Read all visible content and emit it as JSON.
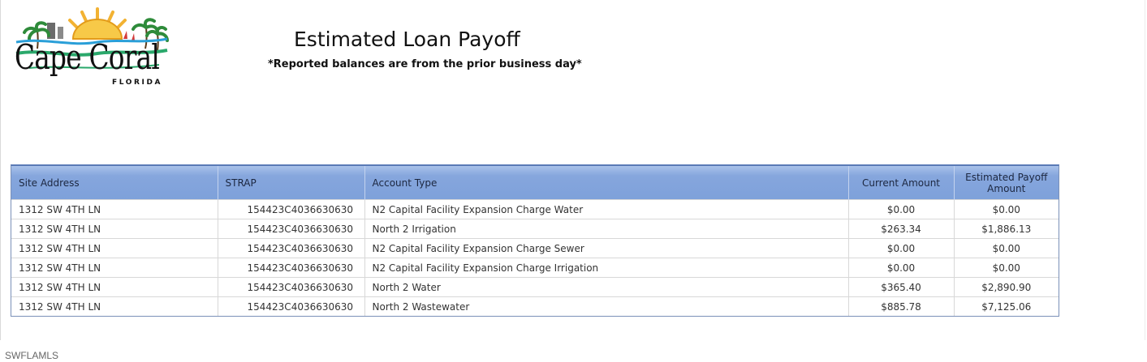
{
  "logo": {
    "word": "Cape Coral",
    "state": "FLORIDA"
  },
  "header": {
    "title": "Estimated Loan Payoff",
    "subtitle": "*Reported balances are from the prior business day*"
  },
  "table": {
    "columns": [
      "Site Address",
      "STRAP",
      "Account Type",
      "Current Amount",
      "Estimated Payoff Amount"
    ],
    "rows": [
      [
        "1312 SW 4TH LN",
        "154423C4036630630",
        "N2 Capital Facility Expansion Charge Water",
        "$0.00",
        "$0.00"
      ],
      [
        "1312 SW 4TH LN",
        "154423C4036630630",
        "North 2 Irrigation",
        "$263.34",
        "$1,886.13"
      ],
      [
        "1312 SW 4TH LN",
        "154423C4036630630",
        "N2 Capital Facility Expansion Charge Sewer",
        "$0.00",
        "$0.00"
      ],
      [
        "1312 SW 4TH LN",
        "154423C4036630630",
        "N2 Capital Facility Expansion Charge Irrigation",
        "$0.00",
        "$0.00"
      ],
      [
        "1312 SW 4TH LN",
        "154423C4036630630",
        "North 2 Water",
        "$365.40",
        "$2,890.90"
      ],
      [
        "1312 SW 4TH LN",
        "154423C4036630630",
        "North 2 Wastewater",
        "$885.78",
        "$7,125.06"
      ]
    ]
  },
  "footer": {
    "watermark": "SWFLAMLS"
  },
  "colors": {
    "header_bg": "#7ea1da",
    "header_border": "#5a7ab6",
    "sun": "#f2b233",
    "water": "#2aa86b",
    "palm": "#2e8b3a"
  }
}
